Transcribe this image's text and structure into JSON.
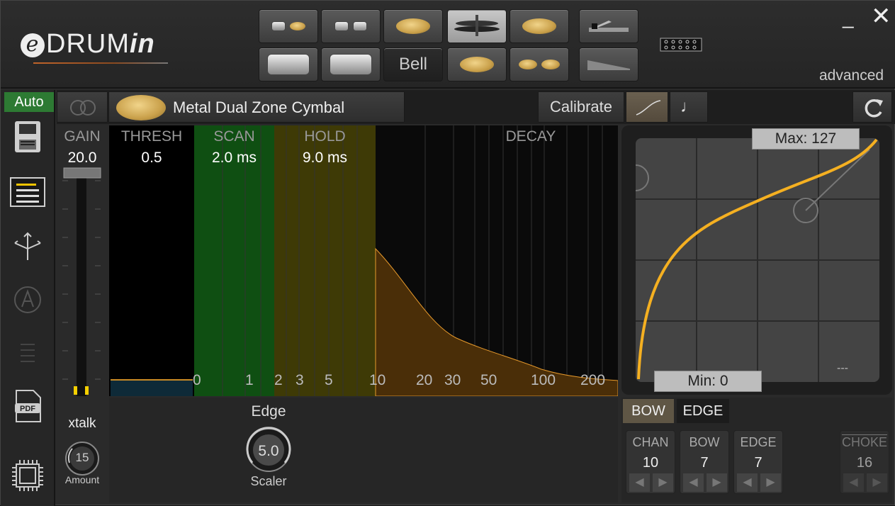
{
  "app": {
    "logo_e": "e",
    "logo_drum": "DRUM",
    "logo_in": "in",
    "mode_label": "advanced",
    "minimize_glyph": "_",
    "close_glyph": "✕"
  },
  "header": {
    "bell_label": "Bell"
  },
  "sidebar": {
    "auto_label": "Auto"
  },
  "toolbar": {
    "pad_name": "Metal Dual Zone Cymbal",
    "calibrate_label": "Calibrate",
    "note_glyph": "♩"
  },
  "params": {
    "gain_label": "GAIN",
    "gain_value": "20.0",
    "thresh_label": "THRESH",
    "thresh_value": "0.5",
    "scan_label": "SCAN",
    "scan_value": "2.0 ms",
    "hold_label": "HOLD",
    "hold_value": "9.0 ms",
    "decay_label": "DECAY"
  },
  "time_axis": {
    "ticks": [
      "0",
      "1",
      "2",
      "3",
      "5",
      "10",
      "20",
      "30",
      "50",
      "100",
      "200"
    ]
  },
  "xtalk": {
    "label": "xtalk",
    "value": "15",
    "amount_label": "Amount"
  },
  "edge_knob": {
    "title": "Edge",
    "value": "5.0",
    "sub": "Scaler"
  },
  "curve": {
    "max_label": "Max: 127",
    "min_label": "Min: 0",
    "corner_label": "---"
  },
  "zones": {
    "bow_tab": "BOW",
    "edge_tab": "EDGE"
  },
  "midi": {
    "chan_label": "CHAN",
    "chan_value": "10",
    "bow_label": "BOW",
    "bow_value": "7",
    "edge_label": "EDGE",
    "edge_value": "7",
    "choke_label": "CHOKE",
    "choke_value": "16",
    "left_arrow": "◀",
    "right_arrow": "▶"
  },
  "colors": {
    "accent_orange": "#f5a623",
    "scan_green": "#0f4f12",
    "hold_olive": "#3e3a06",
    "decay_brown": "#4a2e08",
    "auto_green": "#2d7a33"
  }
}
